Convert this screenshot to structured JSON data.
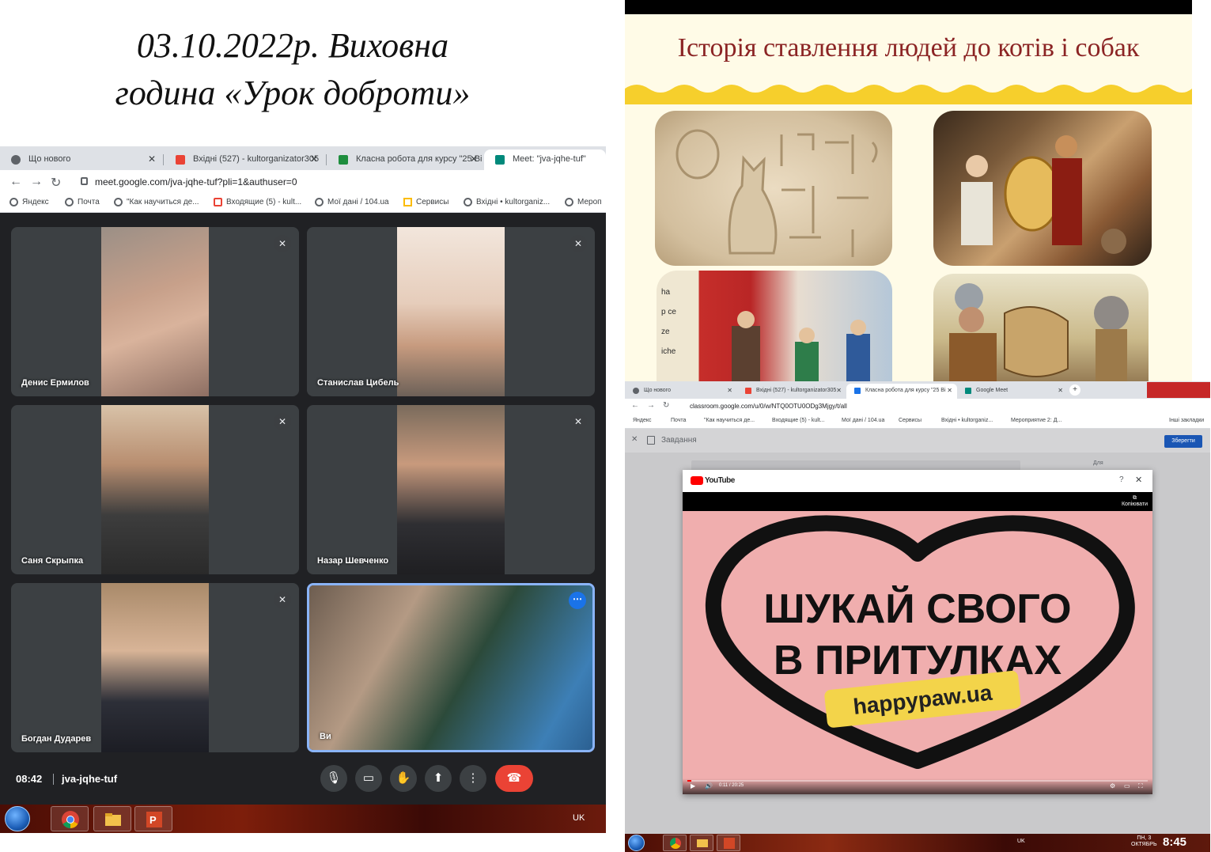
{
  "title": {
    "line1": "03.10.2022р. Виховна",
    "line2": "година «Урок доброти»"
  },
  "meet": {
    "tabs": [
      {
        "label": "Що нового",
        "icon": "chrome-icon"
      },
      {
        "label": "Вхідні (527) - kultorganizator305",
        "icon": "gmail-icon"
      },
      {
        "label": "Класна робота для курсу \"25 Ві",
        "icon": "classroom-icon"
      },
      {
        "label": "Meet: \"jva-jqhe-tuf\"",
        "icon": "meet-icon"
      }
    ],
    "url": "meet.google.com/jva-jqhe-tuf?pli=1&authuser=0",
    "bookmarks": [
      "Яндекс",
      "Почта",
      "\"Как научиться де...",
      "Входящие (5) - kult...",
      "Мої дані / 104.ua",
      "Сервисы",
      "Вхідні • kultorganiz...",
      "Мероп"
    ],
    "participants": [
      {
        "name": "Денис Ермилов",
        "muted": true
      },
      {
        "name": "Станислав Цибель",
        "muted": true
      },
      {
        "name": "Саня Скрыпка",
        "muted": true
      },
      {
        "name": "Назар Шевченко",
        "muted": true
      },
      {
        "name": "Богдан Дударев",
        "muted": true
      },
      {
        "name": "Ви",
        "muted": false
      }
    ],
    "time": "08:42",
    "code": "jva-jqhe-tuf",
    "controls": [
      "mic-icon",
      "camera-icon",
      "raise-hand-icon",
      "present-icon",
      "more-icon",
      "end-call-icon"
    ],
    "lang": "UK"
  },
  "slide": {
    "title": "Історія ставлення людей до котів і собак"
  },
  "classroom": {
    "tabs": [
      {
        "label": "Що нового"
      },
      {
        "label": "Вхідні (527) - kultorganizator305"
      },
      {
        "label": "Класна робота для курсу \"25 Ві"
      },
      {
        "label": "Google Meet"
      }
    ],
    "url": "classroom.google.com/u/0/w/NTQ0OTU0ODg3Mjgy/t/all",
    "bookmarks": [
      "Яндекс",
      "Почта",
      "\"Как научиться де...",
      "Входящие (5) - kult...",
      "Мої дані / 104.ua",
      "Сервисы",
      "Вхідні • kultorganiz...",
      "Мероприятие 2: Д...",
      "Інші закладки"
    ],
    "task_title": "Завдання",
    "save_label": "Зберегти",
    "side_label": "Для",
    "youtube": {
      "brand": "YouTube",
      "copy_label": "Копіювати",
      "video_text_line1": "ШУКАЙ СВОГО",
      "video_text_line2": "В ПРИТУЛКАХ",
      "video_link": "happypaw.ua",
      "time": "0:11 / 20:25",
      "progress": 0.009
    },
    "clock": "8:45",
    "date_day": "ПН, 3",
    "date_month": "ОКТЯБРЬ",
    "lang": "UK"
  }
}
